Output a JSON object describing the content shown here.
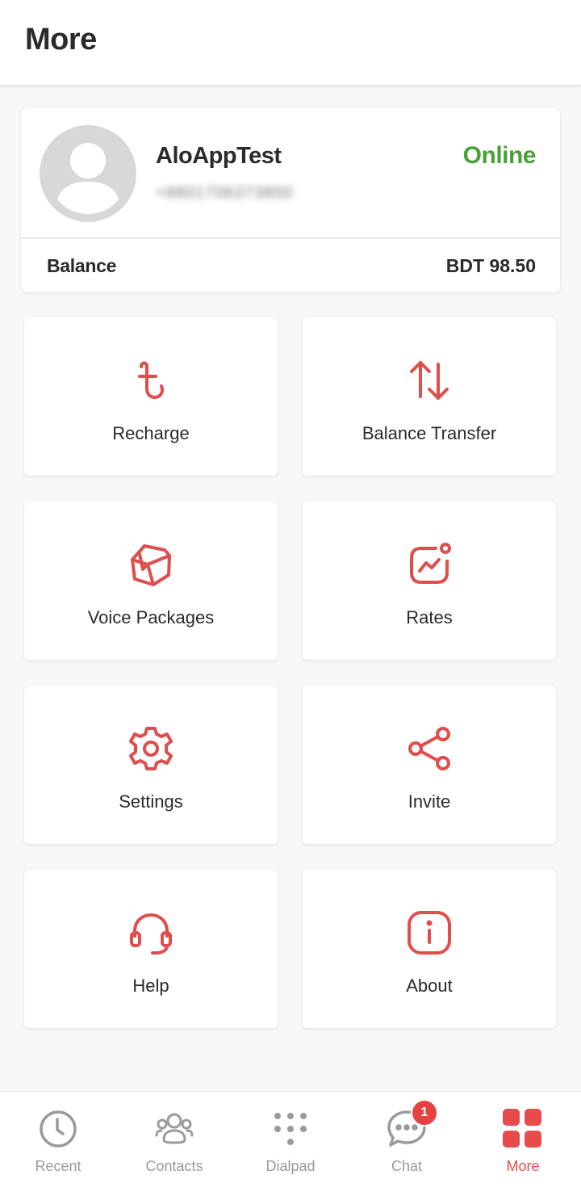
{
  "header": {
    "title": "More"
  },
  "profile": {
    "name": "AloAppTest",
    "phone": "+8801706373800",
    "status": "Online",
    "balance_label": "Balance",
    "balance_value": "BDT 98.50"
  },
  "menu": [
    {
      "label": "Recharge",
      "icon": "taka-icon"
    },
    {
      "label": "Balance Transfer",
      "icon": "transfer-arrows-icon"
    },
    {
      "label": "Voice Packages",
      "icon": "package-box-icon"
    },
    {
      "label": "Rates",
      "icon": "rates-chart-icon"
    },
    {
      "label": "Settings",
      "icon": "gear-icon"
    },
    {
      "label": "Invite",
      "icon": "share-icon"
    },
    {
      "label": "Help",
      "icon": "headset-icon"
    },
    {
      "label": "About",
      "icon": "info-icon"
    }
  ],
  "nav": {
    "items": [
      {
        "label": "Recent",
        "icon": "clock-icon"
      },
      {
        "label": "Contacts",
        "icon": "contacts-icon"
      },
      {
        "label": "Dialpad",
        "icon": "dialpad-icon"
      },
      {
        "label": "Chat",
        "icon": "chat-icon",
        "badge": "1"
      },
      {
        "label": "More",
        "icon": "grid-icon",
        "active": true
      }
    ]
  },
  "colors": {
    "accent": "#e04d4d",
    "online": "#4aa038",
    "inactive": "#9a9a9a"
  }
}
